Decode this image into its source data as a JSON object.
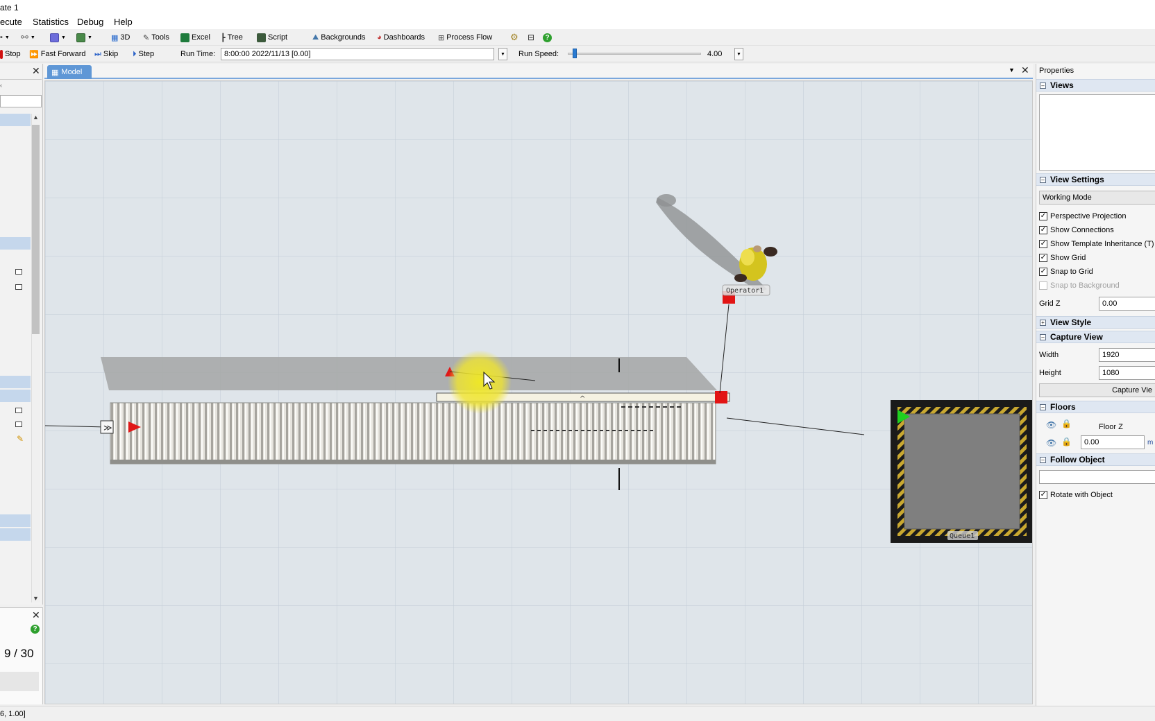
{
  "window": {
    "title": "ate 1"
  },
  "menu": [
    "ecute",
    "Statistics",
    "Debug",
    "Help"
  ],
  "toolbar1": {
    "items": [
      "3D",
      "Tools",
      "Excel",
      "Tree",
      "Script",
      "Backgrounds",
      "Dashboards",
      "Process Flow"
    ]
  },
  "toolbar2": {
    "stop": "Stop",
    "fast_forward": "Fast Forward",
    "skip": "Skip",
    "step": "Step",
    "run_time_label": "Run Time:",
    "run_time_value": "8:00:00  2022/11/13  [0.00]",
    "run_speed_label": "Run Speed:",
    "run_speed_value": "4.00",
    "speed_fraction": 0.05
  },
  "model": {
    "tab_label": "Model"
  },
  "objects": {
    "operator_label": "Operator1",
    "queue_label": "Queue1"
  },
  "leftpanel2": {
    "counter": "9 / 30"
  },
  "status": {
    "coords": "6, 1.00]"
  },
  "properties": {
    "title": "Properties",
    "views_header": "Views",
    "view_settings_header": "View Settings",
    "working_mode": "Working Mode",
    "checkboxes": [
      {
        "label": "Perspective Projection",
        "checked": "✓"
      },
      {
        "label": "Show Connections",
        "checked": "✓"
      },
      {
        "label": "Show Template Inheritance (T)",
        "checked": "✓"
      },
      {
        "label": "Show Grid",
        "checked": "✓"
      },
      {
        "label": "Snap to Grid",
        "checked": "✓"
      },
      {
        "label": "Snap to Background",
        "checked": ""
      }
    ],
    "grid_z_label": "Grid Z",
    "grid_z_value": "0.00",
    "view_style_header": "View Style",
    "capture_view_header": "Capture View",
    "width_label": "Width",
    "width_value": "1920",
    "height_label": "Height",
    "height_value": "1080",
    "capture_button": "Capture Vie",
    "floors_header": "Floors",
    "floor_z_label": "Floor Z",
    "floor_z_value": "0.00",
    "floor_z_unit": "m",
    "follow_object_header": "Follow Object",
    "rotate_with_object": "Rotate with Object"
  }
}
